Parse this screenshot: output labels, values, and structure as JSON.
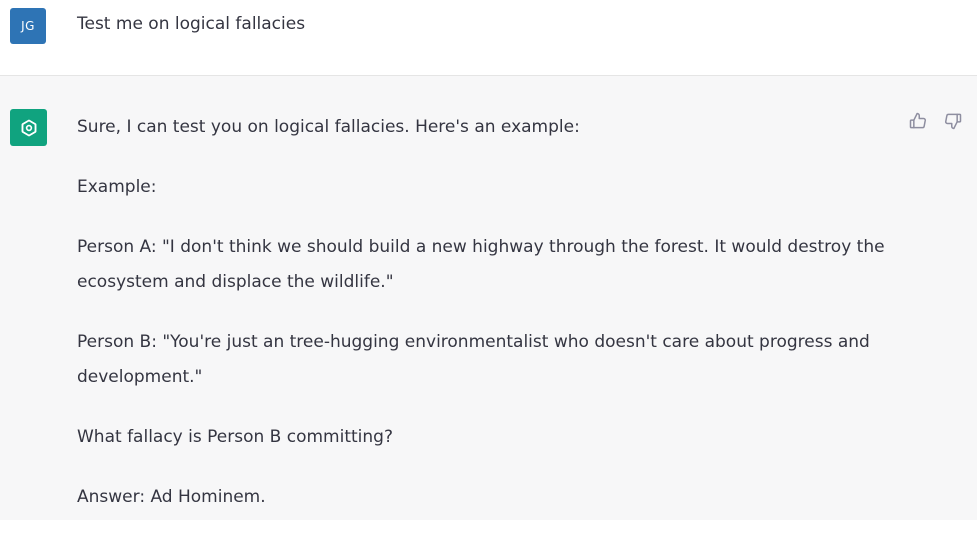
{
  "user": {
    "avatar_initials": "JG",
    "avatar_color": "#2e74b5",
    "message": "Test me on logical fallacies"
  },
  "assistant": {
    "avatar_icon": "openai-logo-icon",
    "avatar_color": "#10a37f",
    "paragraphs": [
      "Sure, I can test you on logical fallacies. Here's an example:",
      "Example:",
      "Person A: \"I don't think we should build a new highway through the forest. It would destroy the ecosystem and displace the wildlife.\"",
      "Person B: \"You're just an tree-hugging environmentalist who doesn't care about progress and development.\"",
      "What fallacy is Person B committing?",
      "Answer: Ad Hominem."
    ],
    "feedback": {
      "thumbs_up_icon": "thumbs-up-icon",
      "thumbs_down_icon": "thumbs-down-icon"
    }
  }
}
